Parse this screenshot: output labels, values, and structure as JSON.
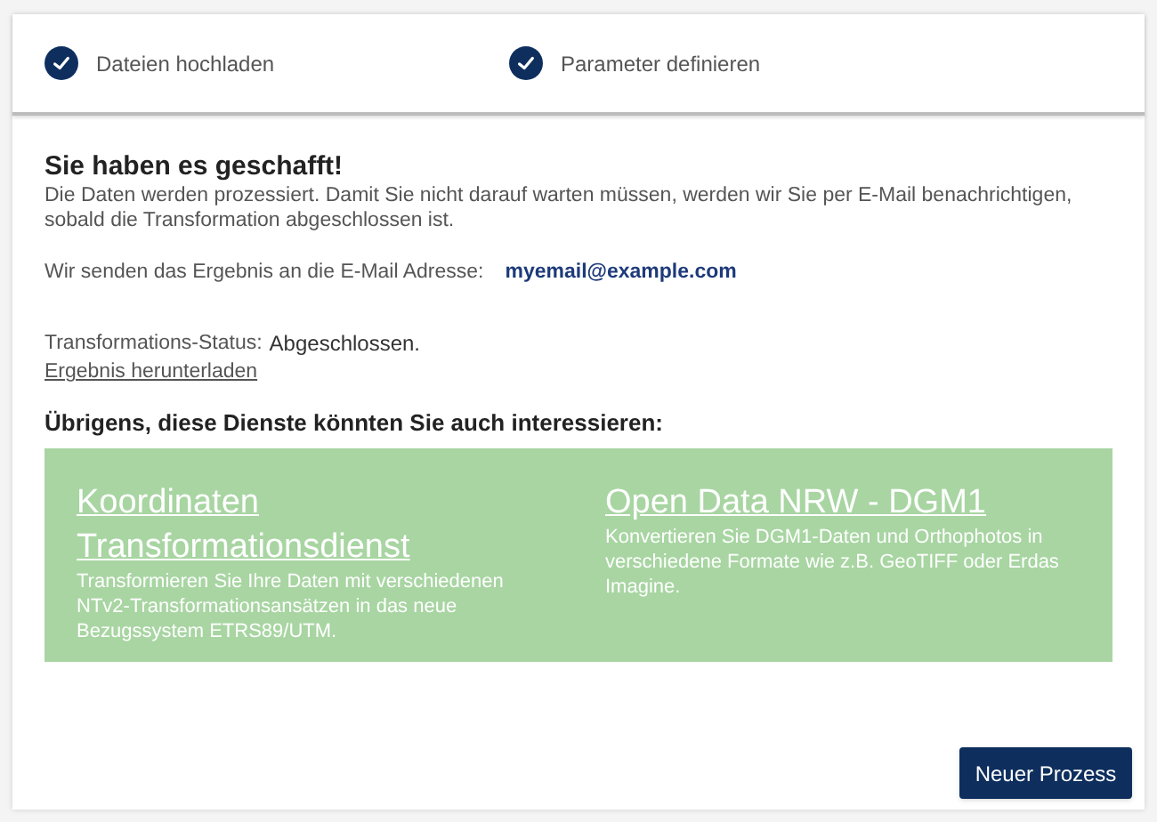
{
  "steps": [
    {
      "label": "Dateien hochladen",
      "completed": true
    },
    {
      "label": "Parameter definieren",
      "completed": true
    }
  ],
  "heading": "Sie haben es geschafft!",
  "intro": "Die Daten werden prozessiert. Damit Sie nicht darauf warten müssen, werden wir Sie per E-Mail benachrichtigen, sobald die Transformation abgeschlossen ist.",
  "email_label": "Wir senden das Ergebnis an die E-Mail Adresse:",
  "email": "myemail@example.com",
  "status_label": "Transformations-Status:",
  "status": "Abgeschlossen.",
  "download_link": "Ergebnis herunterladen",
  "services_heading": "Übrigens, diese Dienste könnten Sie auch interessieren:",
  "services": [
    {
      "title": "Koordinaten Transformationsdienst",
      "description": "Transformieren Sie Ihre Daten mit verschiedenen NTv2-Transformationsansätzen in das neue Bezugssystem ETRS89/UTM."
    },
    {
      "title": "Open Data NRW - DGM1",
      "description": "Konvertieren Sie DGM1-Daten und Orthophotos in verschiedene Formate wie z.B. GeoTIFF oder Erdas Imagine."
    }
  ],
  "button": "Neuer Prozess"
}
